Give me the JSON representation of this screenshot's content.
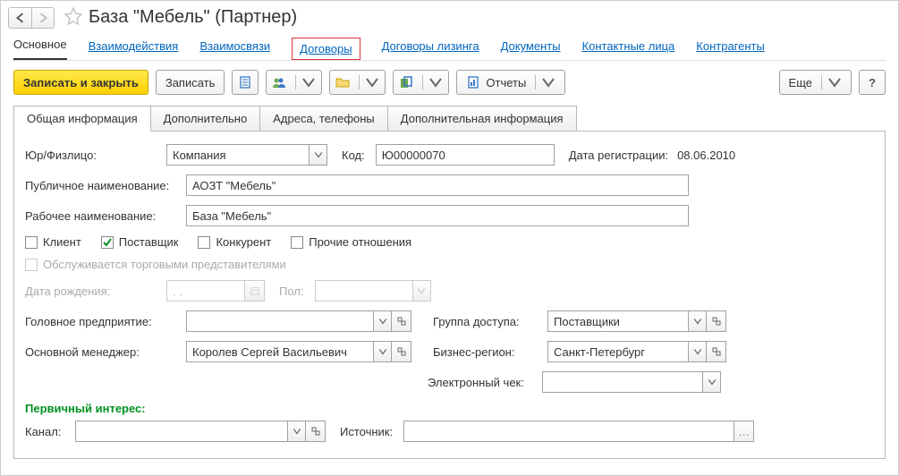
{
  "header": {
    "title": "База \"Мебель\" (Партнер)"
  },
  "linktabs": {
    "main": "Основное",
    "interactions": "Взаимодействия",
    "relations": "Взаимосвязи",
    "contracts": "Договоры",
    "leasing": "Договоры лизинга",
    "documents": "Документы",
    "contacts": "Контактные лица",
    "counterparties": "Контрагенты"
  },
  "toolbar": {
    "save_close": "Записать и закрыть",
    "save": "Записать",
    "reports": "Отчеты",
    "more": "Еще"
  },
  "innertabs": {
    "general": "Общая информация",
    "additional": "Дополнительно",
    "addresses": "Адреса, телефоны",
    "extra": "Дополнительная информация"
  },
  "form": {
    "entity_label": "Юр/Физлицо:",
    "entity_value": "Компания",
    "code_label": "Код:",
    "code_value": "Ю00000070",
    "regdate_label": "Дата регистрации:",
    "regdate_value": "08.06.2010",
    "public_name_label": "Публичное наименование:",
    "public_name_value": "АОЗТ \"Мебель\"",
    "working_name_label": "Рабочее наименование:",
    "working_name_value": "База \"Мебель\"",
    "chk_client": "Клиент",
    "chk_supplier": "Поставщик",
    "chk_competitor": "Конкурент",
    "chk_other": "Прочие отношения",
    "serviced_label": "Обслуживается торговыми представителями",
    "birthdate_label": "Дата рождения:",
    "birthdate_ph": ".  .",
    "gender_label": "Пол:",
    "headorg_label": "Головное предприятие:",
    "accessgroup_label": "Группа доступа:",
    "accessgroup_value": "Поставщики",
    "mainmanager_label": "Основной менеджер:",
    "mainmanager_value": "Королев Сергей Васильевич",
    "bizregion_label": "Бизнес-регион:",
    "bizregion_value": "Санкт-Петербург",
    "echeck_label": "Электронный чек:",
    "interest_header": "Первичный интерес:",
    "channel_label": "Канал:",
    "source_label": "Источник:"
  }
}
